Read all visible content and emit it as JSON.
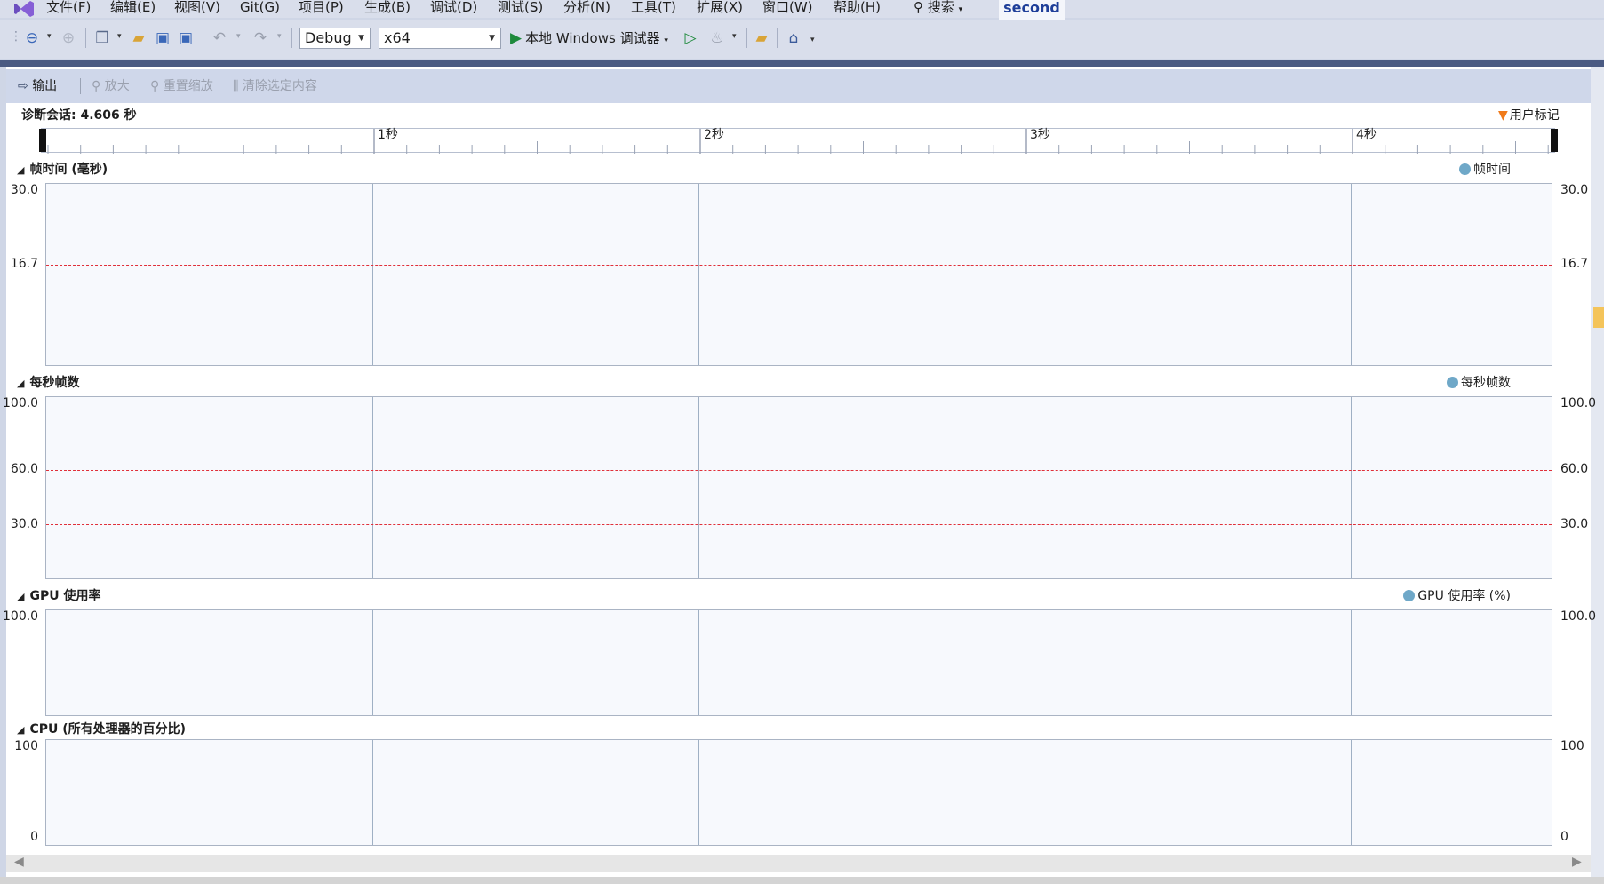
{
  "menu": {
    "items": [
      "文件(F)",
      "编辑(E)",
      "视图(V)",
      "Git(G)",
      "项目(P)",
      "生成(B)",
      "调试(D)",
      "测试(S)",
      "分析(N)",
      "工具(T)",
      "扩展(X)",
      "窗口(W)",
      "帮助(H)"
    ],
    "search_label": "搜索",
    "solution_name": "second"
  },
  "toolbar": {
    "config": "Debug",
    "platform": "x64",
    "run_label": "本地 Windows 调试器"
  },
  "graph_toolbar": {
    "output": "输出",
    "zoom_in": "放大",
    "reset_zoom": "重置缩放",
    "clear_selection": "清除选定内容"
  },
  "session": {
    "label": "诊断会话: 4.606 秒",
    "user_marks": "用户标记"
  },
  "timeline": {
    "ticks": [
      "1秒",
      "2秒",
      "3秒",
      "4秒"
    ]
  },
  "sections": [
    {
      "title": "帧时间 (毫秒)",
      "legend": "帧时间",
      "labels": [
        "30.0",
        "16.7"
      ]
    },
    {
      "title": "每秒帧数",
      "legend": "每秒帧数",
      "labels": [
        "100.0",
        "60.0",
        "30.0"
      ]
    },
    {
      "title": "GPU 使用率",
      "legend": "GPU 使用率 (%)",
      "labels": [
        "100.0"
      ]
    },
    {
      "title": "CPU (所有处理器的百分比)",
      "legend": "",
      "labels": [
        "100",
        "0"
      ]
    }
  ],
  "colors": {
    "legend_dot": "#6fa8c8",
    "threshold_line": "#e0303a",
    "user_mark": "#f07a1a"
  }
}
